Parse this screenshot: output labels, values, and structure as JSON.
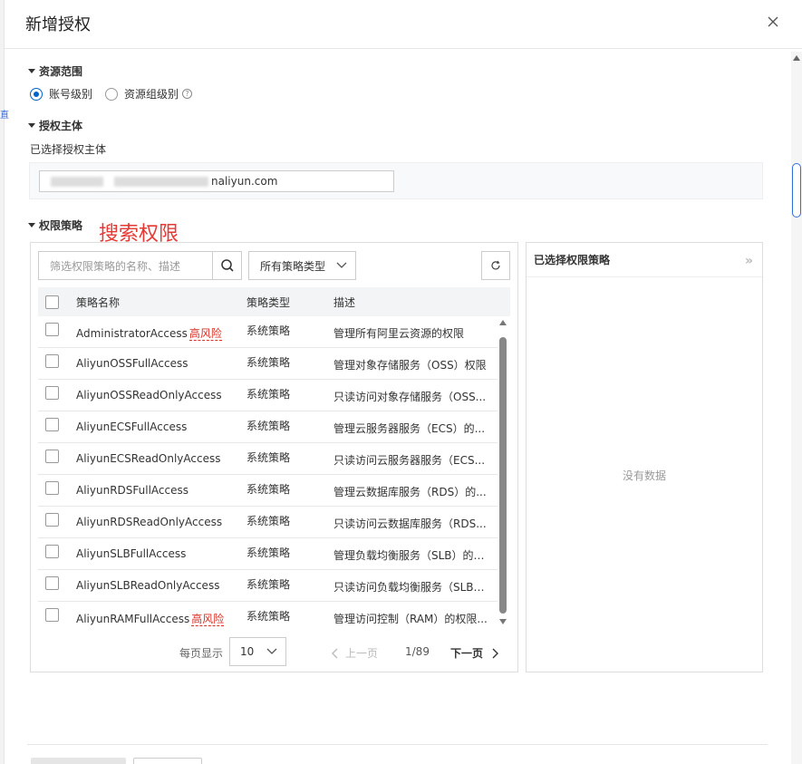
{
  "dialog": {
    "title": "新增授权"
  },
  "left_edge_fragment": "直",
  "resource_scope": {
    "heading": "资源范围",
    "options": [
      {
        "label": "账号级别",
        "selected": true
      },
      {
        "label": "资源组级别",
        "selected": false,
        "help": "?"
      }
    ]
  },
  "principal": {
    "heading": "授权主体",
    "selected_label": "已选择授权主体",
    "value_domain": "naliyun.com"
  },
  "annotation": "搜索权限",
  "policies": {
    "heading": "权限策略",
    "search_placeholder": "筛选权限策略的名称、描述",
    "type_filter": "所有策略类型",
    "columns": {
      "name": "策略名称",
      "type": "策略类型",
      "desc": "描述"
    },
    "risk_label": "高风险",
    "rows": [
      {
        "name": "AdministratorAccess",
        "type": "系统策略",
        "desc": "管理所有阿里云资源的权限",
        "high_risk": true
      },
      {
        "name": "AliyunOSSFullAccess",
        "type": "系统策略",
        "desc": "管理对象存储服务（OSS）权限",
        "high_risk": false
      },
      {
        "name": "AliyunOSSReadOnlyAccess",
        "type": "系统策略",
        "desc": "只读访问对象存储服务（OSS...",
        "high_risk": false
      },
      {
        "name": "AliyunECSFullAccess",
        "type": "系统策略",
        "desc": "管理云服务器服务（ECS）的...",
        "high_risk": false
      },
      {
        "name": "AliyunECSReadOnlyAccess",
        "type": "系统策略",
        "desc": "只读访问云服务器服务（ECS...",
        "high_risk": false
      },
      {
        "name": "AliyunRDSFullAccess",
        "type": "系统策略",
        "desc": "管理云数据库服务（RDS）的...",
        "high_risk": false
      },
      {
        "name": "AliyunRDSReadOnlyAccess",
        "type": "系统策略",
        "desc": "只读访问云数据库服务（RDS...",
        "high_risk": false
      },
      {
        "name": "AliyunSLBFullAccess",
        "type": "系统策略",
        "desc": "管理负载均衡服务（SLB）的权...",
        "high_risk": false
      },
      {
        "name": "AliyunSLBReadOnlyAccess",
        "type": "系统策略",
        "desc": "只读访问负载均衡服务（SLB）...",
        "high_risk": false
      },
      {
        "name": "AliyunRAMFullAccess",
        "type": "系统策略",
        "desc": "管理访问控制（RAM）的权限...",
        "high_risk": true
      }
    ],
    "pagination": {
      "per_page_label": "每页显示",
      "per_page": "10",
      "prev": "上一页",
      "pages": "1/89",
      "next": "下一页"
    }
  },
  "selected_policies": {
    "heading": "已选择权限策略",
    "expand": "»",
    "empty": "没有数据"
  },
  "colors": {
    "accent": "#0064c8",
    "risk": "#d93026",
    "annotation": "#e53935"
  }
}
